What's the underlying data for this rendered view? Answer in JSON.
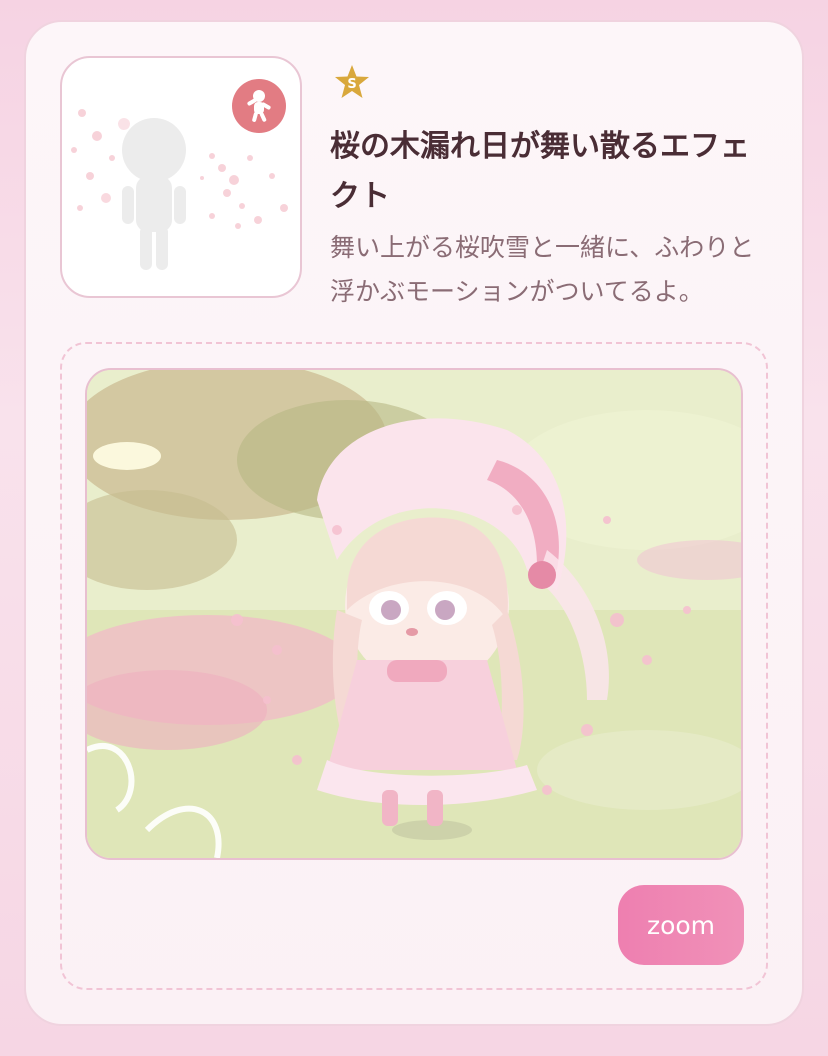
{
  "item": {
    "rank_label": "S",
    "title": "桜の木漏れ日が舞い散るエフェクト",
    "description": "舞い上がる桜吹雪と一緒に、ふわりと浮かぶモーションがついてるよ。",
    "category_icon": "motion-icon",
    "thumbnail_icon": "avatar-silhouette-icon"
  },
  "preview": {
    "image_icon": "avatar-preview-illustration"
  },
  "zoom_button": {
    "label": "zoom"
  },
  "colors": {
    "accent": "#ee7fb0",
    "badge": "#e27c83",
    "rank_star": "#d9a83c",
    "title": "#4a2d35",
    "text": "#8a6c75"
  }
}
